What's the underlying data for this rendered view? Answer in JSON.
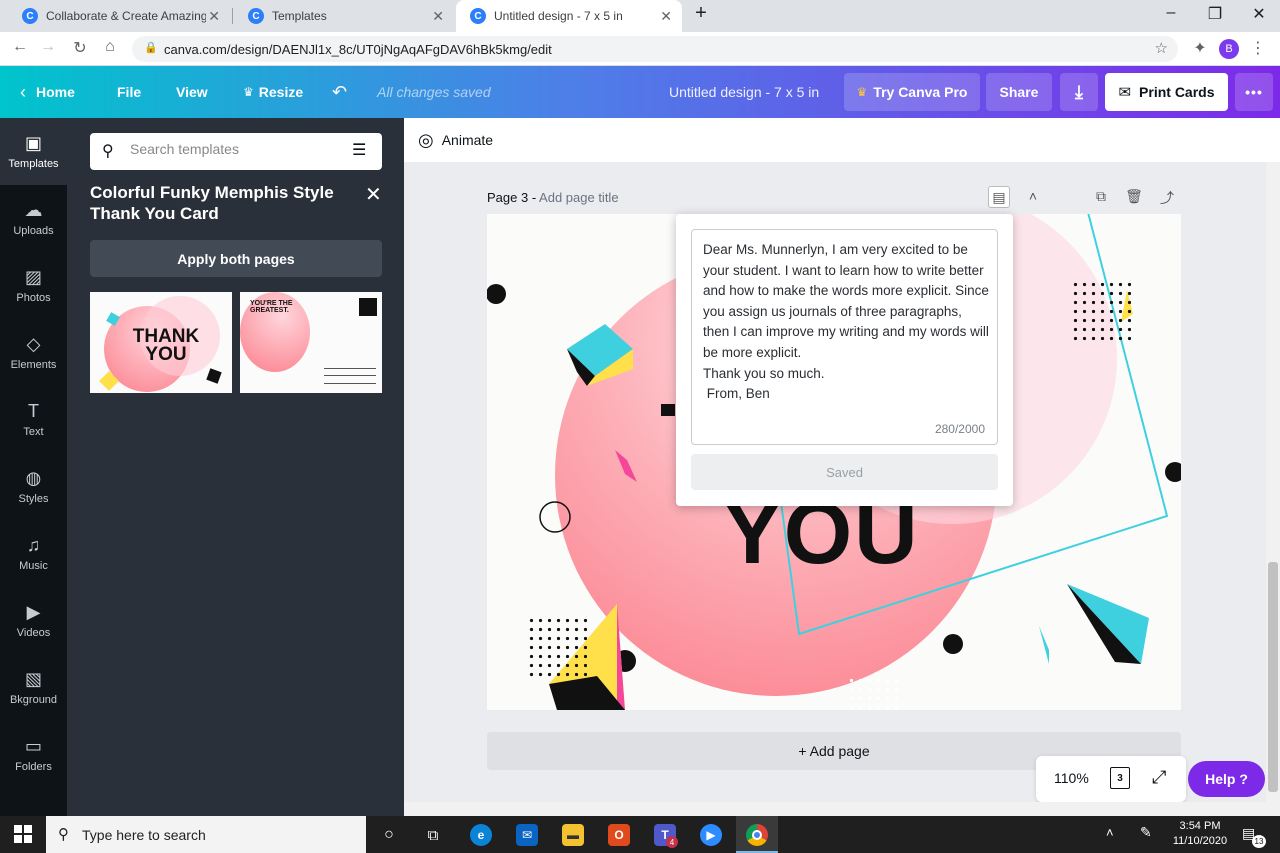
{
  "browser": {
    "tabs": [
      {
        "title": "Collaborate & Create Amazing Gr",
        "favicon": "C"
      },
      {
        "title": "Templates",
        "favicon": "C"
      },
      {
        "title": "Untitled design - 7 x 5 in",
        "favicon": "C"
      }
    ],
    "url": "canva.com/design/DAENJl1x_8c/UT0jNgAqAFgDAV6hBk5kmg/edit",
    "profile_initial": "B"
  },
  "topbar": {
    "home": "Home",
    "file": "File",
    "view": "View",
    "resize": "Resize",
    "status": "All changes saved",
    "doc_title": "Untitled design - 7 x 5 in",
    "try_pro": "Try Canva Pro",
    "share": "Share",
    "print": "Print Cards",
    "more": "•••"
  },
  "rail": [
    {
      "label": "Templates",
      "icon": "▣"
    },
    {
      "label": "Uploads",
      "icon": "☁"
    },
    {
      "label": "Photos",
      "icon": "▨"
    },
    {
      "label": "Elements",
      "icon": "◇"
    },
    {
      "label": "Text",
      "icon": "T"
    },
    {
      "label": "Styles",
      "icon": "◍"
    },
    {
      "label": "Music",
      "icon": "♫"
    },
    {
      "label": "Videos",
      "icon": "▶"
    },
    {
      "label": "Bkground",
      "icon": "▧"
    },
    {
      "label": "Folders",
      "icon": "▭"
    }
  ],
  "panel": {
    "search_placeholder": "Search templates",
    "template_title": "Colorful Funky Memphis Style Thank You Card",
    "apply_label": "Apply both pages",
    "thumb1_text": "THANK YOU",
    "thumb2_text": "YOU'RE THE GREATEST."
  },
  "editor": {
    "animate": "Animate",
    "page_label": "Page 3 - ",
    "page_title_placeholder": "Add page title",
    "canvas_text": "YOU",
    "add_page": "+ Add page",
    "zoom": "110%",
    "page_count": "3",
    "help": "Help  ?"
  },
  "notes": {
    "text": "Dear Ms. Munnerlyn, I am very excited to be your student. I want to learn how to write better and how to make the words more explicit. Since you assign us journals of three paragraphs, then I can improve my writing and my words will be more explicit.\nThank you so much.\n From, Ben",
    "count": "280/2000",
    "saved_label": "Saved"
  },
  "taskbar": {
    "search_placeholder": "Type here to search",
    "time": "3:54 PM",
    "date": "11/10/2020",
    "notifications": "13",
    "teams_badge": "4"
  },
  "colors": {
    "accent_purple": "#7d2ae8",
    "accent_teal": "#00c4cc",
    "canvas_pink": "#fb7d8a",
    "shape_cyan": "#3fd0e0",
    "shape_yellow": "#ffe04a",
    "shape_magenta": "#f5479a"
  }
}
